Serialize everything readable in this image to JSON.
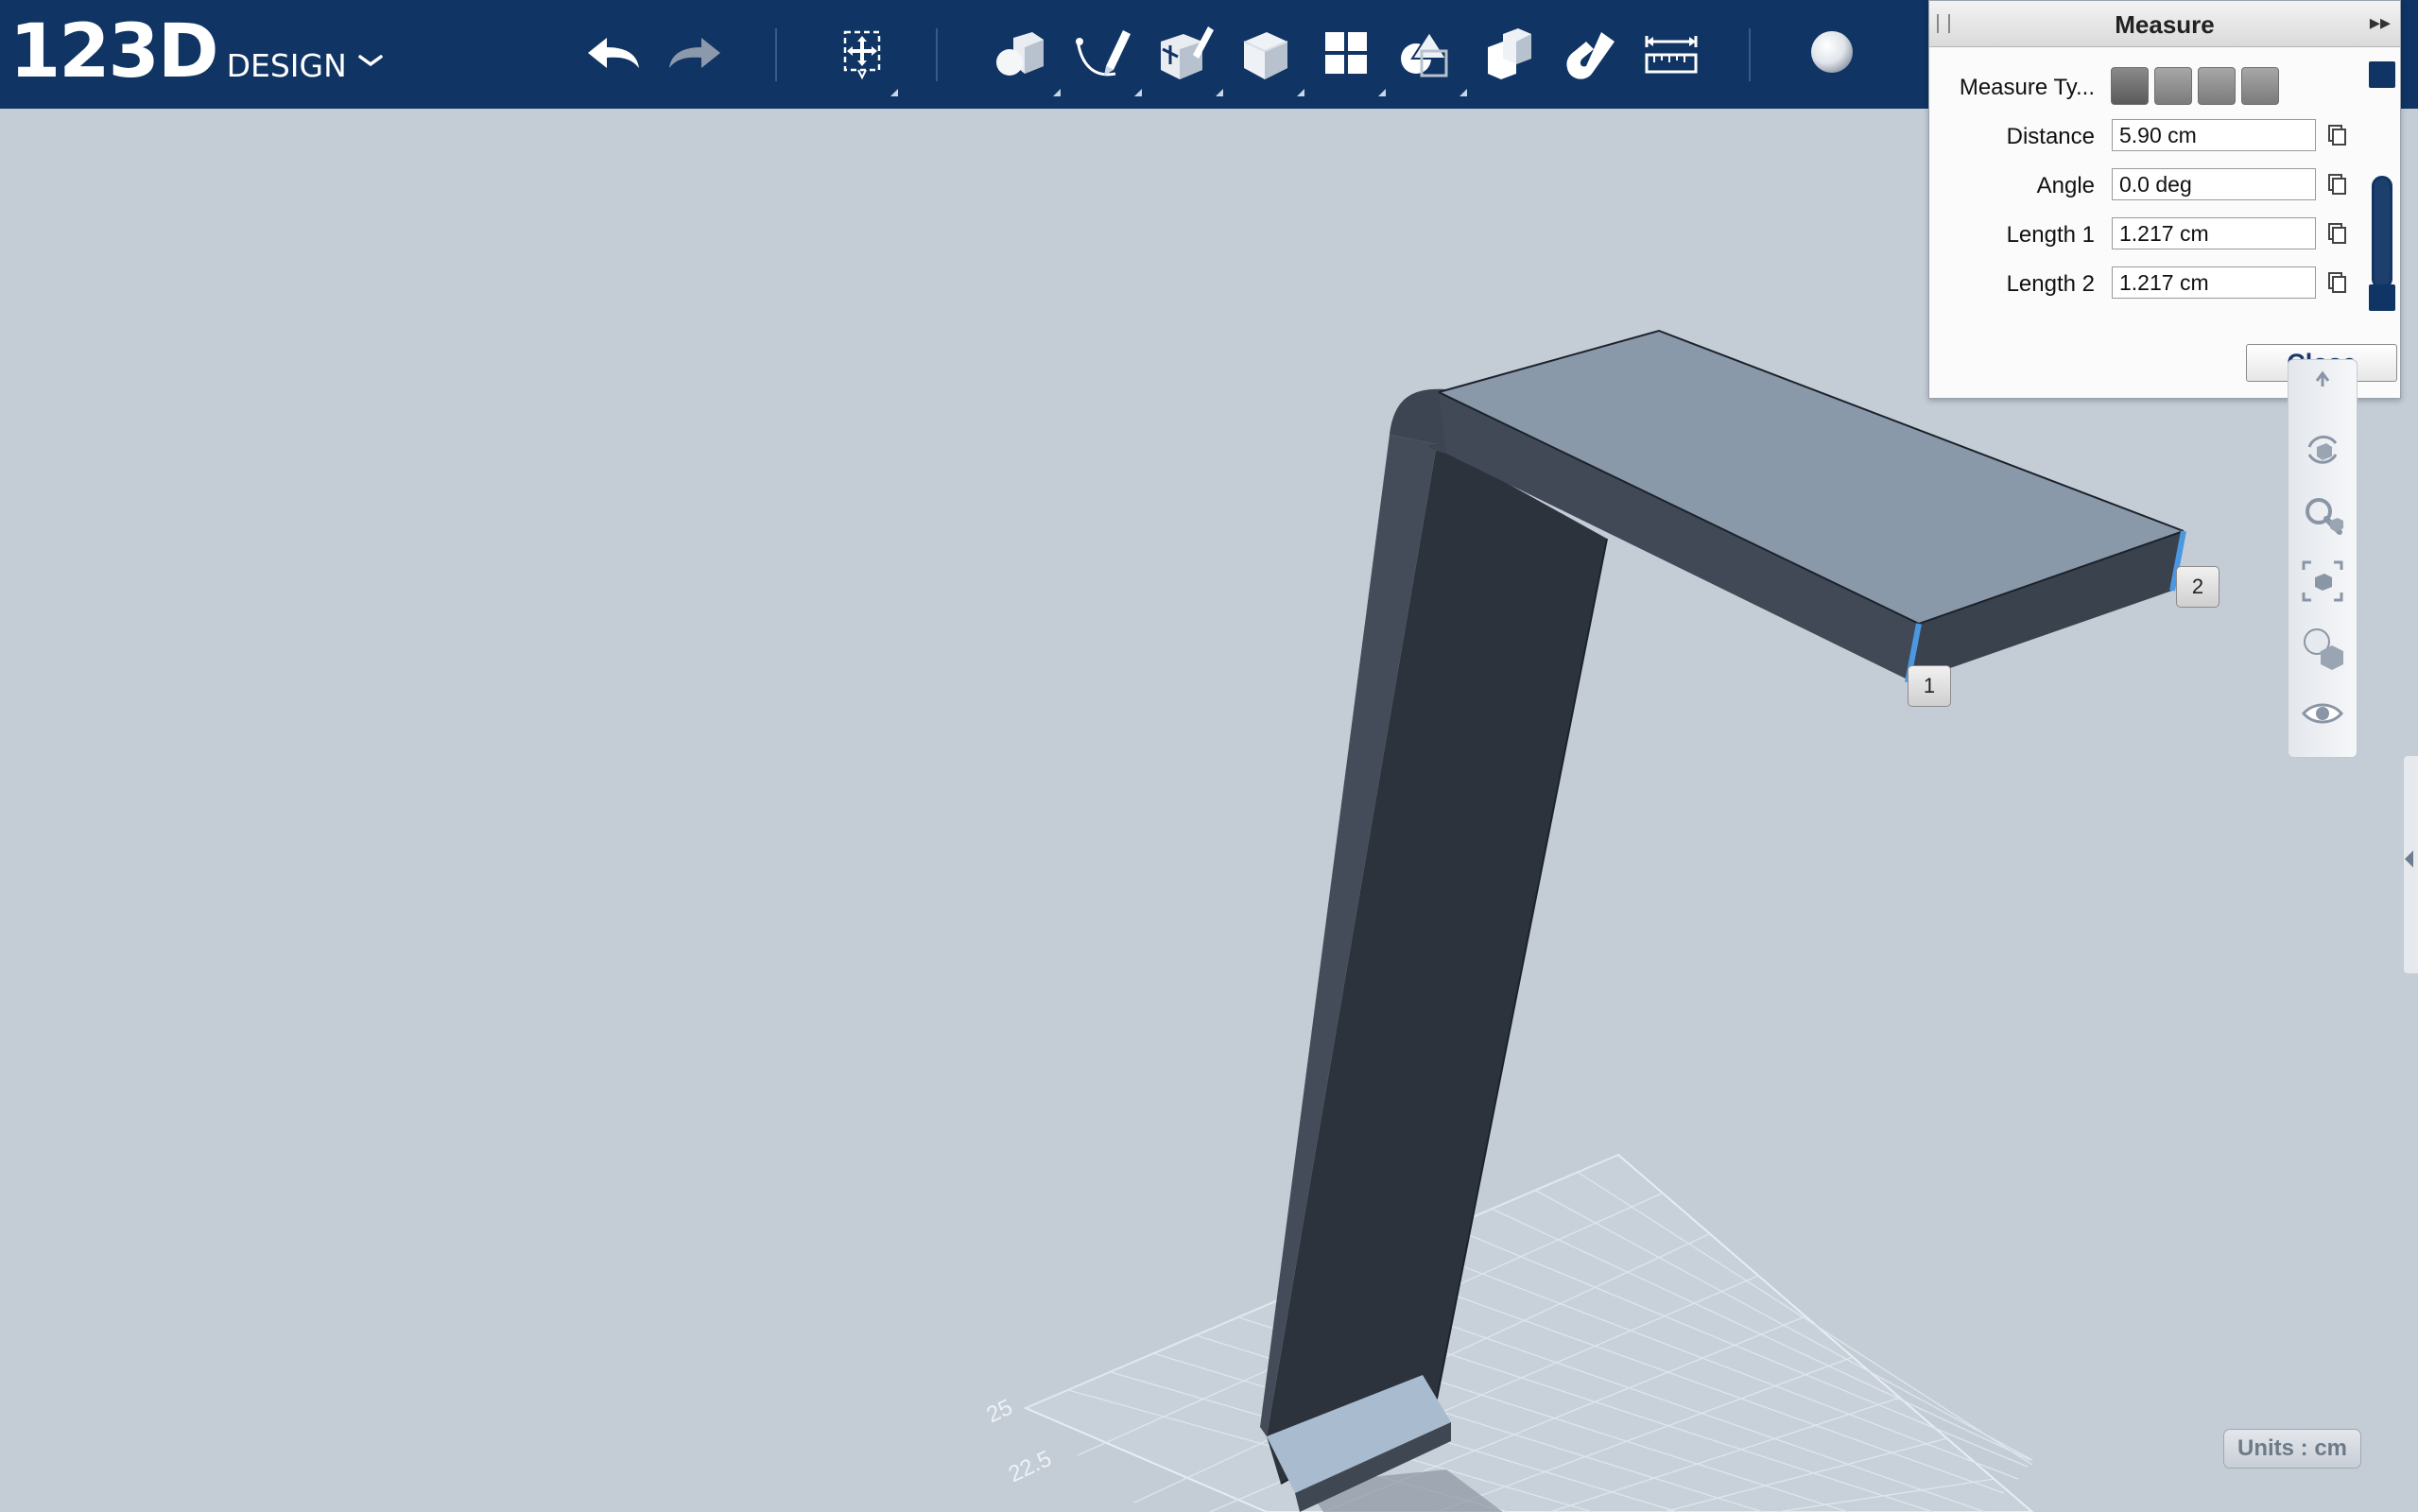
{
  "app": {
    "logo_main": "123D",
    "logo_sub": "DESIGN"
  },
  "toolbar": {
    "icons": [
      "undo-icon",
      "redo-icon",
      "transform-icon",
      "primitives-icon",
      "sketch-icon",
      "construct-icon",
      "modify-icon",
      "pattern-icon",
      "group-icon",
      "combine-icon",
      "snap-icon",
      "measure-icon",
      "material-icon"
    ]
  },
  "measure": {
    "title": "Measure",
    "type_label": "Measure Ty...",
    "fields": [
      {
        "label": "Distance",
        "value": "5.90 cm"
      },
      {
        "label": "Angle",
        "value": "0.0 deg"
      },
      {
        "label": "Length 1",
        "value": "1.217 cm"
      },
      {
        "label": "Length 2",
        "value": "1.217 cm"
      }
    ],
    "close_label": "Close"
  },
  "viewport": {
    "markers": [
      "1",
      "2"
    ],
    "grid_labels": [
      "25",
      "22.5"
    ],
    "units_label": "Units : cm"
  },
  "colors": {
    "brand": "#103463",
    "background": "#c4ccd6",
    "model_top": "#8c9aab",
    "model_side": "#3a4350",
    "selection_edge": "#4a98e0"
  }
}
